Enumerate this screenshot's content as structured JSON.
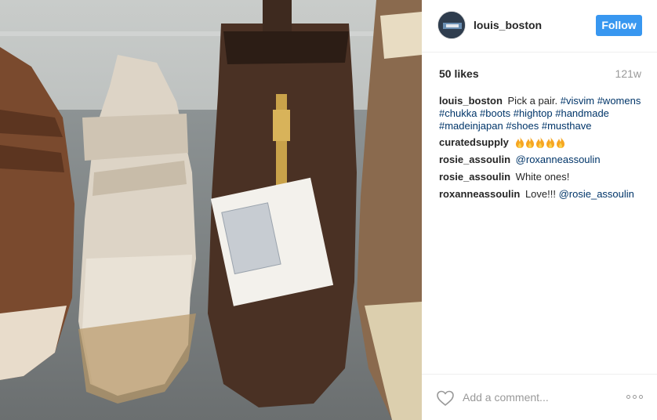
{
  "post": {
    "username": "louis_boston",
    "follow_label": "Follow",
    "likes": "50 likes",
    "time": "121w"
  },
  "caption": {
    "username": "louis_boston",
    "text": "Pick a pair.",
    "tags": [
      "#visvim",
      "#womens",
      "#chukka",
      "#boots",
      "#hightop",
      "#handmade",
      "#madeinjapan",
      "#shoes",
      "#musthave"
    ]
  },
  "comments": [
    {
      "username": "curatedsupply",
      "emoji": "fire",
      "emoji_count": 5
    },
    {
      "username": "rosie_assoulin",
      "mention": "@roxanneassoulin",
      "text": ""
    },
    {
      "username": "rosie_assoulin",
      "mention": "",
      "text": "White ones!"
    },
    {
      "username": "roxanneassoulin",
      "mention": "@rosie_assoulin",
      "text": "Love!!!"
    }
  ],
  "footer": {
    "placeholder": "Add a comment..."
  },
  "colors": {
    "follow_button": "#3897f0",
    "hashtag": "#003569",
    "muted": "#999999"
  },
  "icons": [
    "heart-icon",
    "more-options-icon"
  ]
}
